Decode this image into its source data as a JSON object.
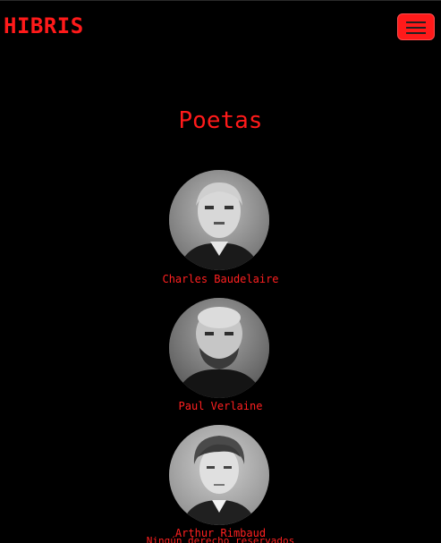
{
  "navbar": {
    "brand": "HIBRIS",
    "toggler_icon": "hamburger-menu-icon",
    "accent_color": "#ff1a1a"
  },
  "main": {
    "title": "Poetas",
    "poets": [
      {
        "name": "Charles Baudelaire"
      },
      {
        "name": "Paul Verlaine"
      },
      {
        "name": "Arthur Rimbaud"
      }
    ]
  },
  "footer": {
    "text": "Ningún derecho reservados"
  }
}
